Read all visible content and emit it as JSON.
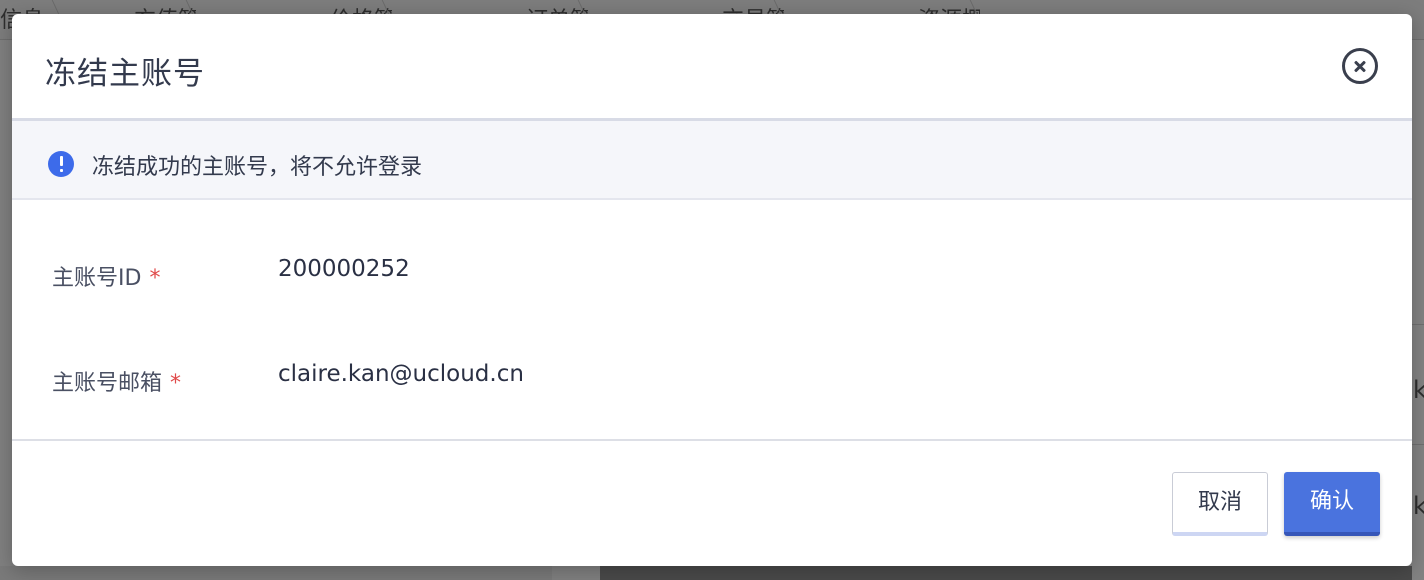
{
  "background": {
    "tabs": [
      "信息",
      "充值管理",
      "价格管理",
      "订单管理",
      "交易管理",
      "资源概览"
    ],
    "right_glyphs": [
      "k",
      "k"
    ]
  },
  "modal": {
    "title": "冻结主账号",
    "alert": "冻结成功的主账号，将不允许登录",
    "fields": [
      {
        "label": "主账号ID",
        "required": "*",
        "value": "200000252"
      },
      {
        "label": "主账号邮箱",
        "required": "*",
        "value": "claire.kan@ucloud.cn"
      }
    ],
    "buttons": {
      "cancel": "取消",
      "confirm": "确认"
    }
  },
  "colors": {
    "accent": "#4a73de",
    "info_icon": "#3d6bea",
    "required": "#e04a4a"
  }
}
